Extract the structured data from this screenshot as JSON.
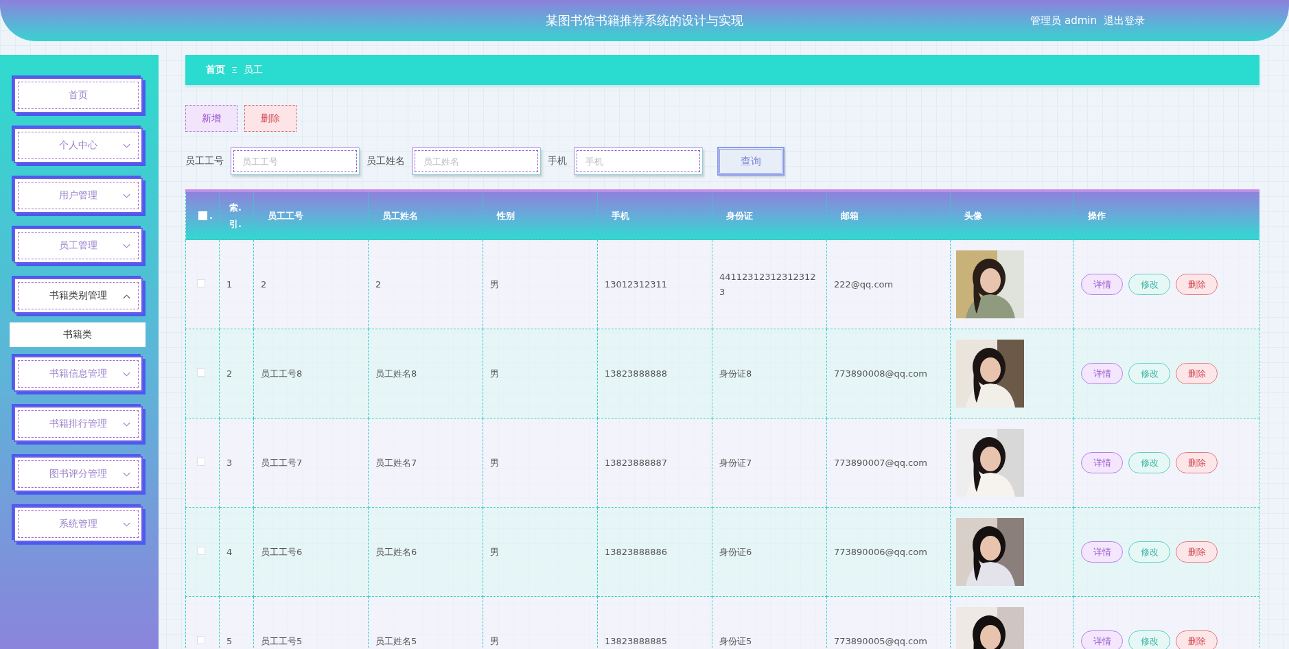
{
  "header": {
    "title": "某图书馆书籍推荐系统的设计与实现",
    "user": "管理员 admin",
    "logout": "退出登录"
  },
  "sidebar": {
    "items": [
      {
        "label": "首页",
        "kind": "link"
      },
      {
        "label": "个人中心",
        "kind": "menu",
        "expanded": false
      },
      {
        "label": "用户管理",
        "kind": "menu",
        "expanded": false
      },
      {
        "label": "员工管理",
        "kind": "menu",
        "expanded": false
      },
      {
        "label": "书籍类别管理",
        "kind": "menu",
        "expanded": true,
        "children": [
          {
            "label": "书籍类"
          }
        ]
      },
      {
        "label": "书籍信息管理",
        "kind": "menu",
        "expanded": false
      },
      {
        "label": "书籍排行管理",
        "kind": "menu",
        "expanded": false
      },
      {
        "label": "图书评分管理",
        "kind": "menu",
        "expanded": false
      },
      {
        "label": "系统管理",
        "kind": "menu",
        "expanded": false
      }
    ]
  },
  "breadcrumb": [
    "首页",
    "员工"
  ],
  "toolbar": [
    {
      "label": "新增",
      "kind": "add"
    },
    {
      "label": "删除",
      "kind": "delete"
    }
  ],
  "search": {
    "fields": [
      {
        "label": "员工工号",
        "placeholder": "员工工号"
      },
      {
        "label": "员工姓名",
        "placeholder": "员工姓名"
      },
      {
        "label": "手机",
        "placeholder": "手机"
      }
    ],
    "button": "查询"
  },
  "table": {
    "header_checkbox": {
      "checked": false,
      "label": "."
    },
    "columns": [
      "索.引.",
      "员工工号",
      "员工姓名",
      "性别",
      "手机",
      "身份证",
      "邮箱",
      "头像",
      "操作"
    ],
    "rows": [
      {
        "checked": false,
        "cells": [
          "1",
          "2",
          "2",
          "男",
          "13012312311",
          "441123123123123123",
          "222@qq.com"
        ],
        "actions": [
          {
            "label": "详情",
            "kind": "detail"
          },
          {
            "label": "修改",
            "kind": "edit"
          },
          {
            "label": "删除",
            "kind": "delete"
          }
        ]
      },
      {
        "checked": false,
        "cells": [
          "2",
          "员工工号8",
          "员工姓名8",
          "男",
          "13823888888",
          "身份证8",
          "773890008@qq.com"
        ],
        "actions": [
          {
            "label": "详情",
            "kind": "detail"
          },
          {
            "label": "修改",
            "kind": "edit"
          },
          {
            "label": "删除",
            "kind": "delete"
          }
        ]
      },
      {
        "checked": false,
        "cells": [
          "3",
          "员工工号7",
          "员工姓名7",
          "男",
          "13823888887",
          "身份证7",
          "773890007@qq.com"
        ],
        "actions": [
          {
            "label": "详情",
            "kind": "detail"
          },
          {
            "label": "修改",
            "kind": "edit"
          },
          {
            "label": "删除",
            "kind": "delete"
          }
        ]
      },
      {
        "checked": false,
        "cells": [
          "4",
          "员工工号6",
          "员工姓名6",
          "男",
          "13823888886",
          "身份证6",
          "773890006@qq.com"
        ],
        "actions": [
          {
            "label": "详情",
            "kind": "detail"
          },
          {
            "label": "修改",
            "kind": "edit"
          },
          {
            "label": "删除",
            "kind": "delete"
          }
        ]
      },
      {
        "checked": false,
        "cells": [
          "5",
          "员工工号5",
          "员工姓名5",
          "男",
          "13823888885",
          "身份证5",
          "773890005@qq.com"
        ],
        "actions": [
          {
            "label": "详情",
            "kind": "detail"
          },
          {
            "label": "修改",
            "kind": "edit"
          },
          {
            "label": "删除",
            "kind": "delete"
          }
        ]
      }
    ]
  }
}
